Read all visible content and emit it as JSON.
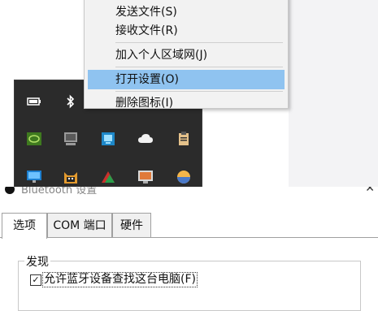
{
  "context_menu": {
    "items": [
      {
        "label": "发送文件(S)"
      },
      {
        "label": "接收文件(R)"
      },
      {
        "label": "加入个人区域网(J)"
      },
      {
        "label": "打开设置(O)",
        "highlighted": true
      },
      {
        "label": "删除图标(I)"
      }
    ],
    "highlight_color": "#8fc3f0"
  },
  "tray": {
    "icons": [
      "battery-icon",
      "bluetooth-icon",
      "nvidia-icon",
      "display-icon",
      "network-adapter-icon",
      "cloud-icon",
      "clipboard-icon",
      "monitor-icon",
      "cat-app-icon",
      "colored-app-icon",
      "screen-icon",
      "circle-app-icon"
    ]
  },
  "dialog": {
    "title": "Bluetooth 设置",
    "tabs": [
      {
        "label": "选项",
        "active": true
      },
      {
        "label": "COM 端口",
        "active": false
      },
      {
        "label": "硬件",
        "active": false
      }
    ],
    "group_label": "发现",
    "checkbox_label": "允许蓝牙设备查找这台电脑(F)",
    "checkbox_checked": "☑"
  }
}
